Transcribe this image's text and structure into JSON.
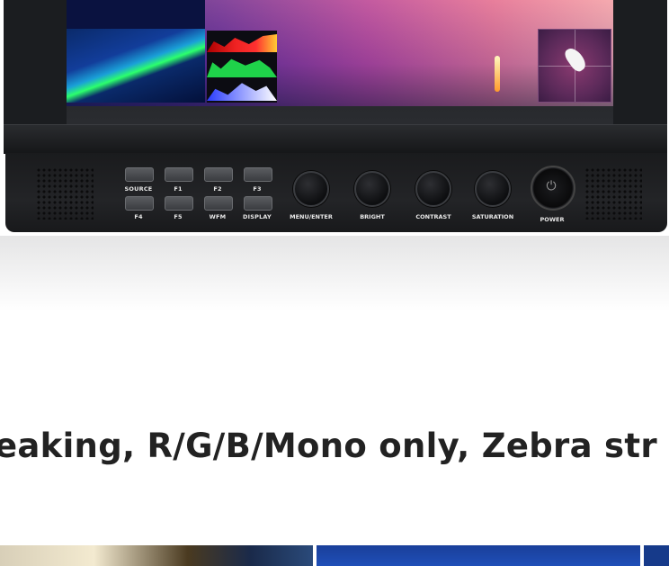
{
  "monitor": {
    "buttons_top": [
      "SOURCE",
      "F1",
      "F2",
      "F3"
    ],
    "buttons_bottom": [
      "F4",
      "F5",
      "WFM",
      "DISPLAY"
    ],
    "knobs": [
      "MENU/ENTER",
      "BRIGHT",
      "CONTRAST",
      "SATURATION"
    ],
    "power_label": "POWER",
    "power_icon": "power-icon"
  },
  "headline": "eaking, R/G/B/Mono only, Zebra str",
  "colors": {
    "monitor_body": "#1d1f22",
    "headline_text": "#222222",
    "thumb_blue": "#1f4fb8"
  }
}
